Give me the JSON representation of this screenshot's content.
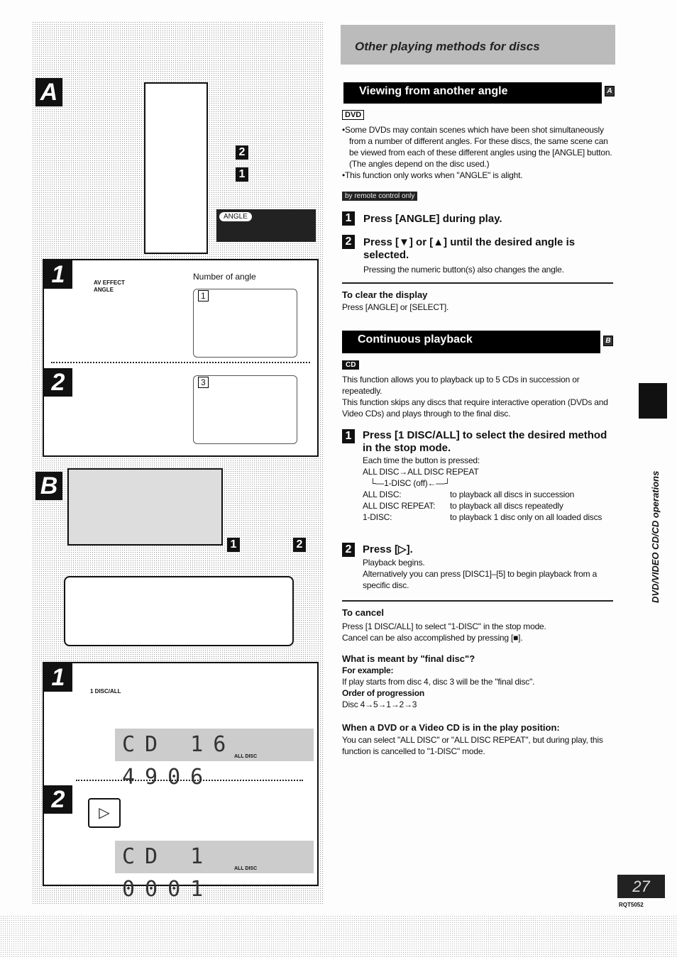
{
  "header": {
    "title": "Other playing methods for discs"
  },
  "illustration": {
    "section_a": "A",
    "section_b": "B",
    "step1": "1",
    "step2": "2",
    "angle_badge": "ANGLE",
    "av_effect": "AV EFFECT",
    "angle": "ANGLE",
    "number_of_angle": "Number of angle",
    "disc_all": "1 DISC/ALL",
    "lcd1": "CD 16 4906",
    "lcd2": "CD 1 0001",
    "all_disc": "ALL DISC",
    "angle_num_1": "1",
    "angle_num_3": "3"
  },
  "angle_section": {
    "title": "Viewing from another angle",
    "letter": "A",
    "disc_tag": "DVD",
    "bullets": [
      "Some DVDs may contain scenes which have been shot simultaneously from a number of different angles. For these discs, the same scene can be viewed from each of these different angles using the [ANGLE] button. (The angles depend on the disc used.)",
      "This function only works when \"ANGLE\" is alight."
    ],
    "remote_tag": "by remote control only",
    "steps": [
      {
        "num": "1",
        "text": "Press [ANGLE] during play.",
        "note": ""
      },
      {
        "num": "2",
        "text": "Press [▼] or [▲] until the desired angle is selected.",
        "note": "Pressing the numeric button(s) also changes the angle."
      }
    ],
    "clear_title": "To clear the display",
    "clear_text": "Press [ANGLE] or [SELECT]."
  },
  "continuous_section": {
    "title": "Continuous playback",
    "letter": "B",
    "disc_tag": "CD",
    "intro": [
      "This function allows you to playback up to 5 CDs in succession or repeatedly.",
      "This function skips any discs that require interactive operation (DVDs and Video CDs) and plays through to the final disc."
    ],
    "step1": {
      "num": "1",
      "text": "Press [1 DISC/ALL] to select the desired method in the stop mode.",
      "note": "Each time the button is pressed:",
      "cycle1": "ALL DISC→ALL DISC REPEAT",
      "cycle2": "└—1-DISC (off)←—┘",
      "modes": [
        {
          "name": "ALL DISC:",
          "desc": "to playback all discs in succession"
        },
        {
          "name": "ALL DISC REPEAT:",
          "desc": "to playback all discs repeatedly"
        },
        {
          "name": "1-DISC:",
          "desc": "to playback 1 disc only on all loaded discs"
        }
      ]
    },
    "step2": {
      "num": "2",
      "text": "Press [▷].",
      "note1": "Playback begins.",
      "note2": "Alternatively you can press [DISC1]–[5] to begin playback from a specific disc."
    },
    "cancel_title": "To cancel",
    "cancel_text": [
      "Press [1 DISC/ALL] to select \"1-DISC\" in the stop mode.",
      "Cancel can be also accomplished by pressing [■]."
    ],
    "final_title": "What is meant by \"final disc\"?",
    "example_label": "For example:",
    "example_text": "If play starts from disc 4, disc 3 will be the \"final disc\".",
    "order_label": "Order of progression",
    "order_text": "Disc 4→5→1→2→3",
    "dvd_title": "When a DVD or a Video CD is in the play position:",
    "dvd_text": "You can select \"ALL DISC\" or \"ALL DISC REPEAT\", but during play, this function is cancelled to \"1-DISC\" mode."
  },
  "side_tab": "DVD/VIDEO CD/CD operations",
  "footer": {
    "page": "27",
    "code": "RQT5052"
  }
}
